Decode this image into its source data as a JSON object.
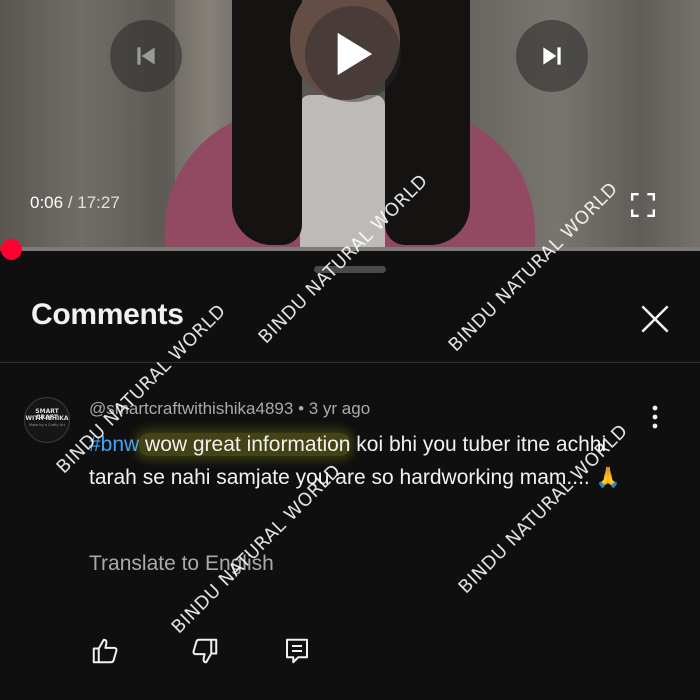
{
  "player": {
    "current_time": "0:06",
    "separator": " / ",
    "duration": "17:27",
    "progress": 0.006,
    "accent_color": "#ff0033"
  },
  "panel": {
    "title": "Comments"
  },
  "comment": {
    "avatar_line1": "SMART CRAFT",
    "avatar_line2": "WITH ISHIKA",
    "avatar_line3": "Make by a Crafty Art",
    "author": "@smartcraftwithishika4893",
    "meta_separator": " • ",
    "age": "3 yr ago",
    "hashtag": "#bnw",
    "highlighted_text": " wow great information",
    "body_rest": " koi bhi you tuber itne achhi tarah se nahi samjate you are so hardworking mam....",
    "emoji": "🙏",
    "translate_label": "Translate to English",
    "hashtag_color": "#3ea6ff"
  },
  "icons": {
    "previous": "skip-previous-icon",
    "play": "play-icon",
    "next": "skip-next-icon",
    "fullscreen": "fullscreen-icon",
    "close": "close-icon",
    "more": "more-vert-icon",
    "like": "thumb-up-icon",
    "dislike": "thumb-down-icon",
    "reply": "comment-icon"
  },
  "watermark": {
    "text": "BINDU NATURAL WORLD"
  }
}
